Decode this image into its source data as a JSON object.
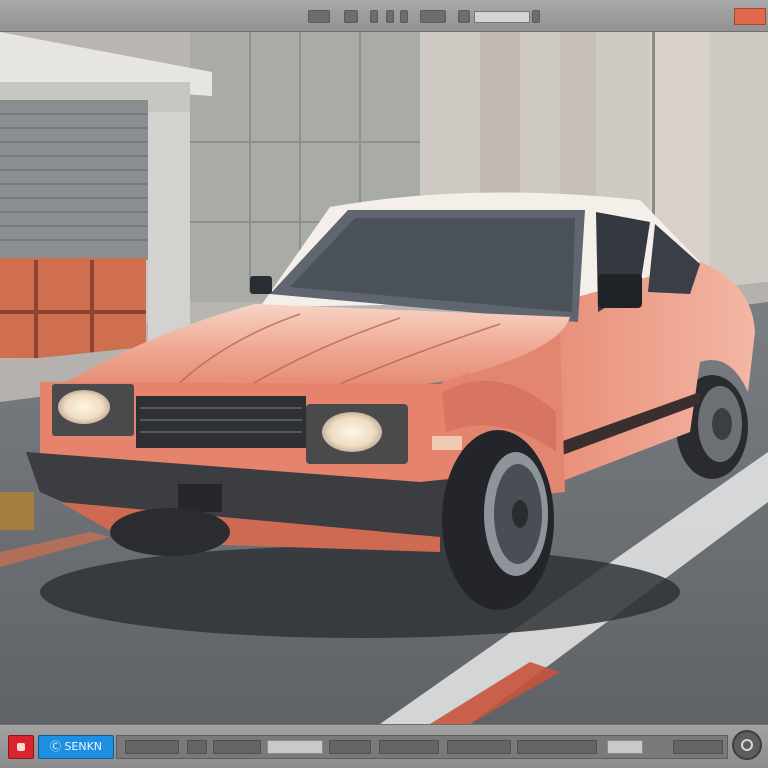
{
  "bottom_toolbar": {
    "brand_label": "Ⓒ SENKN"
  },
  "colors": {
    "toolbar": "#a0a0a0",
    "accent_orange": "#e06a4a",
    "record_red": "#d8242c",
    "brand_blue": "#1d8fe0",
    "car_body": "#e48a72"
  },
  "icons": [
    "record-icon",
    "settings-dial-icon"
  ]
}
